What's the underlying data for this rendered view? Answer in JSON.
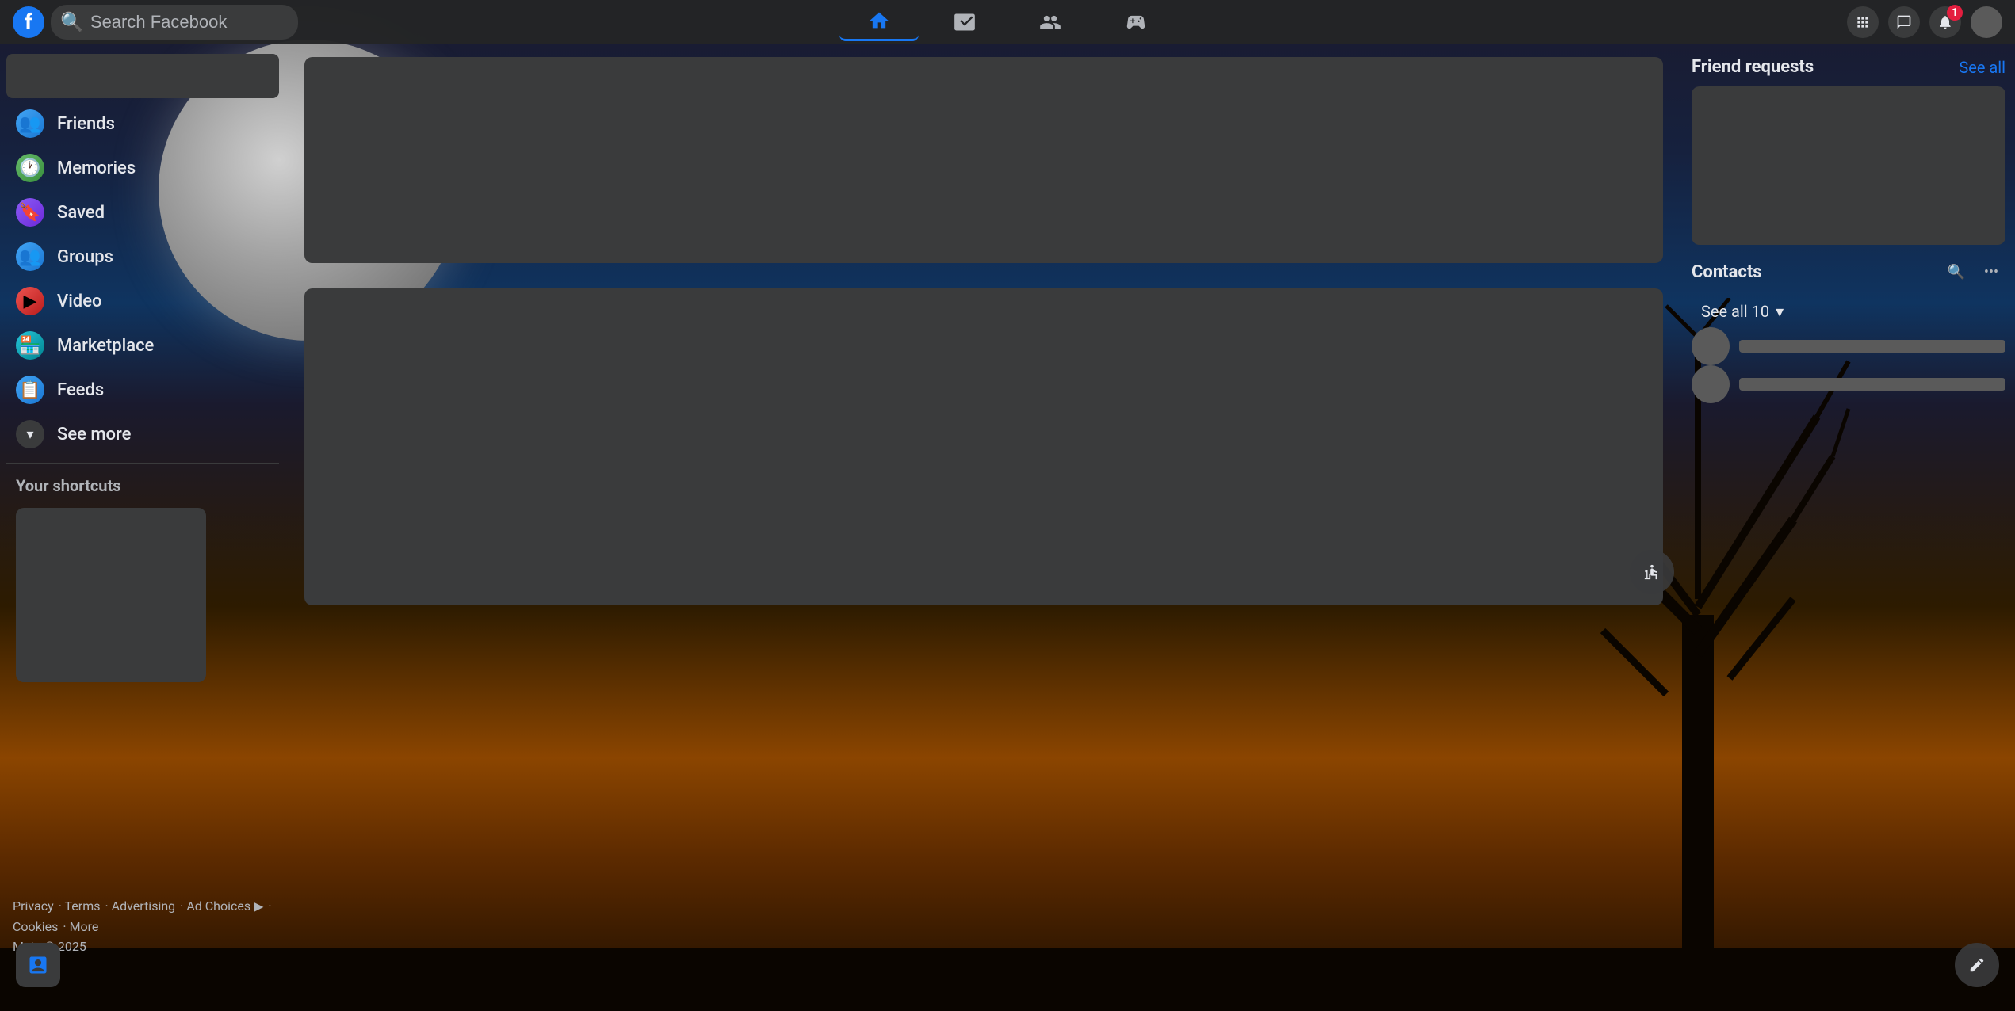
{
  "app": {
    "title": "Facebook"
  },
  "header": {
    "logo": "f",
    "search_placeholder": "Search Facebook",
    "nav_items": [
      {
        "id": "home",
        "label": "Home",
        "active": true
      },
      {
        "id": "video",
        "label": "Watch"
      },
      {
        "id": "people",
        "label": "People"
      },
      {
        "id": "gaming",
        "label": "Gaming"
      }
    ],
    "right_icons": [
      {
        "id": "grid",
        "label": "Menu"
      },
      {
        "id": "messenger",
        "label": "Messenger"
      },
      {
        "id": "notifications",
        "label": "Notifications",
        "badge": "1"
      },
      {
        "id": "account",
        "label": "Account"
      }
    ]
  },
  "sidebar": {
    "items": [
      {
        "id": "friends",
        "label": "Friends",
        "icon": "👥"
      },
      {
        "id": "memories",
        "label": "Memories",
        "icon": "🕐"
      },
      {
        "id": "saved",
        "label": "Saved",
        "icon": "🔖"
      },
      {
        "id": "groups",
        "label": "Groups",
        "icon": "👥"
      },
      {
        "id": "video",
        "label": "Video",
        "icon": "▶"
      },
      {
        "id": "marketplace",
        "label": "Marketplace",
        "icon": "🏪"
      },
      {
        "id": "feeds",
        "label": "Feeds",
        "icon": "📋"
      }
    ],
    "see_more_label": "See more",
    "shortcuts_title": "Your shortcuts"
  },
  "right_panel": {
    "friend_requests_title": "Friend requests",
    "see_all_label": "See all",
    "contacts_title": "Contacts",
    "see_all_contacts_label": "See all 10"
  },
  "footer": {
    "links": [
      "Privacy",
      "Terms",
      "Advertising",
      "Ad Choices",
      "Cookies",
      "More"
    ],
    "copyright": "Meta © 2025"
  }
}
